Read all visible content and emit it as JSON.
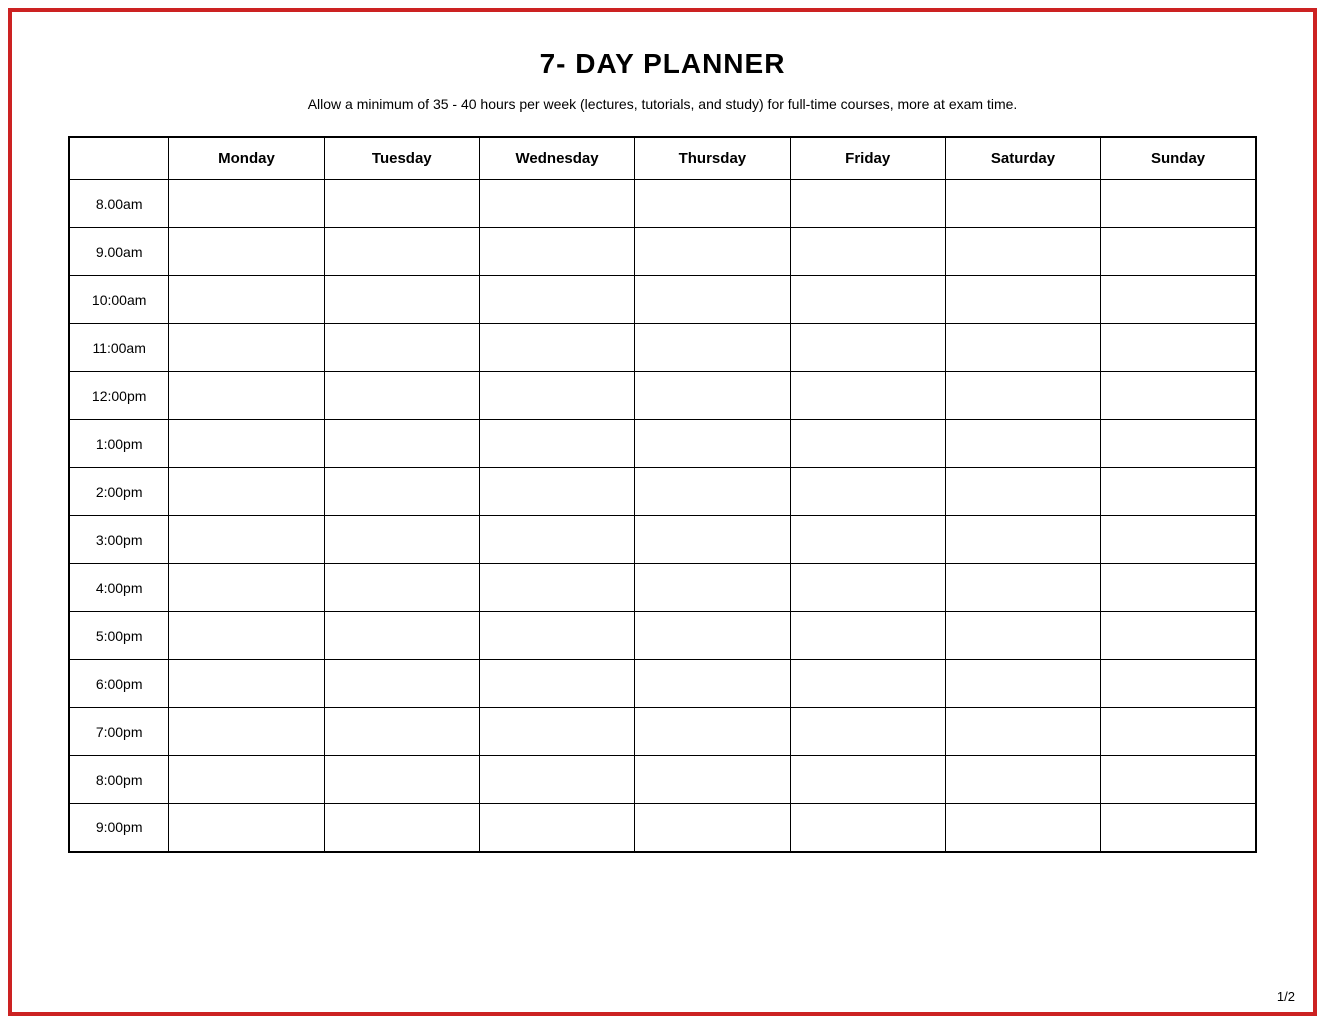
{
  "title": "7- DAY PLANNER",
  "subtitle": "Allow a minimum of 35 - 40 hours per week (lectures, tutorials, and study) for full-time courses, more at exam time.",
  "page_number": "1/2",
  "columns": [
    {
      "label": "Monday"
    },
    {
      "label": "Tuesday"
    },
    {
      "label": "Wednesday"
    },
    {
      "label": "Thursday"
    },
    {
      "label": "Friday"
    },
    {
      "label": "Saturday"
    },
    {
      "label": "Sunday"
    }
  ],
  "time_slots": [
    "8.00am",
    "9.00am",
    "10:00am",
    "11:00am",
    "12:00pm",
    "1:00pm",
    "2:00pm",
    "3:00pm",
    "4:00pm",
    "5:00pm",
    "6:00pm",
    "7:00pm",
    "8:00pm",
    "9:00pm"
  ]
}
